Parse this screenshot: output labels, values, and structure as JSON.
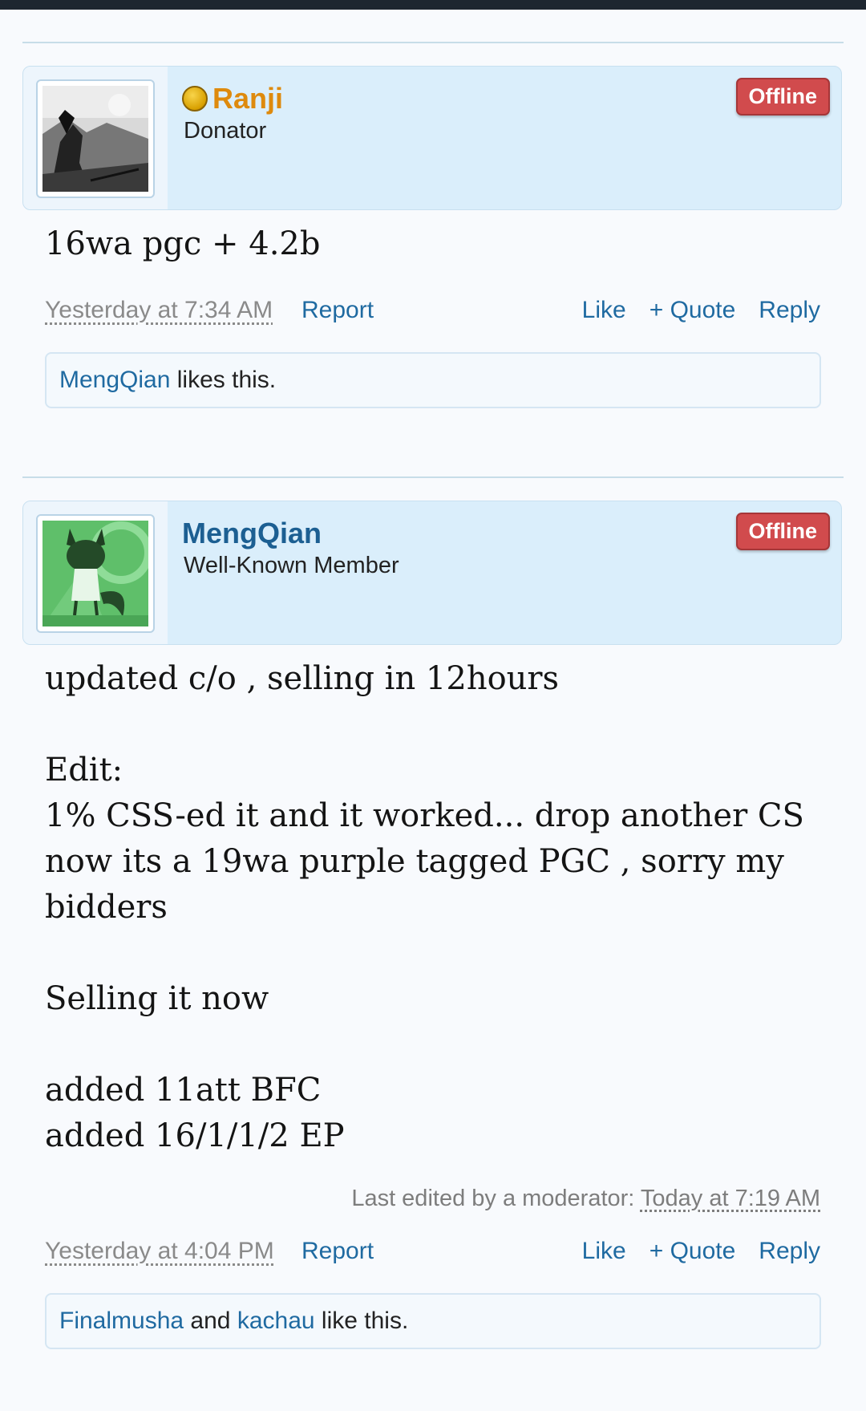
{
  "posts": [
    {
      "username": "Ranji",
      "user_title": "Donator",
      "status": "Offline",
      "message_lines": [
        "16wa pgc + 4.2b"
      ],
      "edit_note": null,
      "timestamp": "Yesterday at 7:34 AM",
      "report_label": "Report",
      "actions": {
        "like": "Like",
        "quote": "+ Quote",
        "reply": "Reply"
      },
      "likes": {
        "users": [
          "MengQian"
        ],
        "suffix": "likes this."
      }
    },
    {
      "username": "MengQian",
      "user_title": "Well-Known Member",
      "status": "Offline",
      "message_lines": [
        "updated c/o , selling in 12hours",
        "",
        "Edit:",
        "1% CSS-ed it and it worked... drop another CS",
        "now its a 19wa purple tagged PGC , sorry my",
        "bidders",
        "",
        "Selling it now",
        "",
        "added 11att BFC",
        "added 16/1/1/2 EP"
      ],
      "edit_note": {
        "prefix": "Last edited by a moderator:",
        "time": "Today at 7:19 AM"
      },
      "timestamp": "Yesterday at 4:04 PM",
      "report_label": "Report",
      "actions": {
        "like": "Like",
        "quote": "+ Quote",
        "reply": "Reply"
      },
      "likes": {
        "users": [
          "Finalmusha",
          "kachau"
        ],
        "conjunction": "and",
        "suffix": "like this."
      }
    }
  ],
  "colors": {
    "donator_name": "#de8a0d",
    "member_name": "#1c5f92",
    "link": "#1f6aa1",
    "offline_badge": "#d14b4d",
    "card_bg": "#daeefb"
  },
  "icons": {
    "donator_badge": "gold-coin-icon"
  }
}
